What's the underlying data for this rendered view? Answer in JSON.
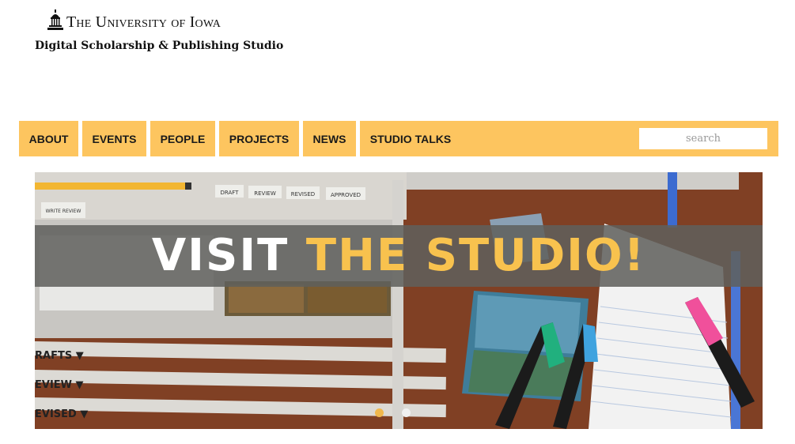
{
  "header": {
    "university_name": "The University of Iowa",
    "studio_name": "Digital Scholarship & Publishing Studio"
  },
  "nav": {
    "items": [
      {
        "label": "ABOUT"
      },
      {
        "label": "EVENTS"
      },
      {
        "label": "PEOPLE"
      },
      {
        "label": "PROJECTS"
      },
      {
        "label": "NEWS"
      },
      {
        "label": "STUDIO TALKS"
      }
    ],
    "search_placeholder": "search"
  },
  "hero": {
    "headline_part1": "VISIT",
    "headline_part2": "THE STUDIO!",
    "board_labels": [
      "DRAFT",
      "REVIEW",
      "REVISED",
      "APPROVED",
      "WRITE REVIEW",
      "RAFTS ▼",
      "EVIEW ▼",
      "EVISED ▼"
    ],
    "carousel": {
      "slides": 2,
      "active_slide": 1
    }
  },
  "colors": {
    "nav_bg": "#fdc55f",
    "accent_text": "#f8c24e",
    "banner_bg": "#5f5f5c"
  }
}
